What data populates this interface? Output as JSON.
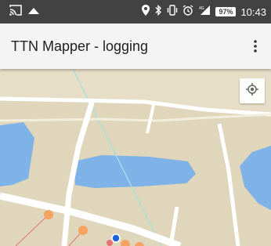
{
  "status_bar": {
    "battery": "97%",
    "time": "10:43",
    "background": "#424242",
    "icons": [
      "cast-icon",
      "cloud-icon",
      "location-icon",
      "bluetooth-icon",
      "vibrate-icon",
      "alarm-icon",
      "signal-icon",
      "battery-icon"
    ]
  },
  "app_bar": {
    "title": "TTN Mapper - logging",
    "background": "#f4f4f4",
    "menu_icon": "more-vert-icon"
  },
  "map": {
    "land_color": "#dfd6bb",
    "water_color": "#7fb2e6",
    "road_color": "#ffffff",
    "marker_color": "#f4a460",
    "current_marker_color": "#1e63d6",
    "link_color": "#e57373",
    "locate_icon": "my-location-icon"
  }
}
